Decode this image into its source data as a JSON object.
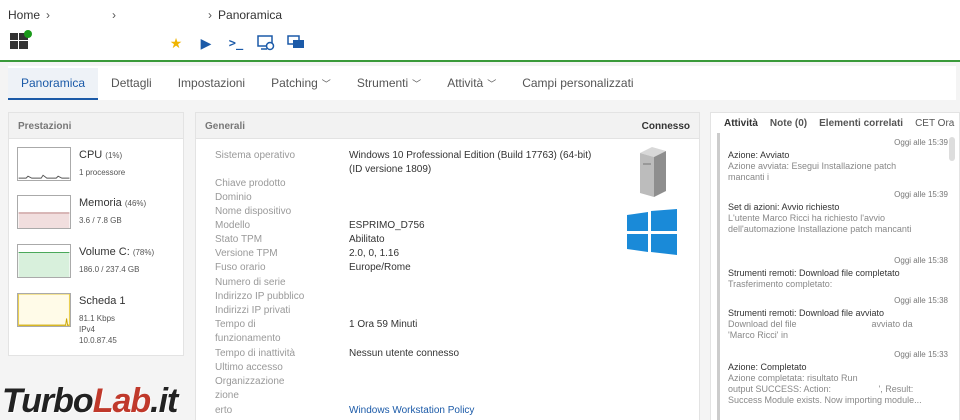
{
  "breadcrumb": {
    "home": "Home",
    "current": "Panoramica"
  },
  "tabs": [
    {
      "label": "Panoramica"
    },
    {
      "label": "Dettagli"
    },
    {
      "label": "Impostazioni"
    },
    {
      "label": "Patching"
    },
    {
      "label": "Strumenti"
    },
    {
      "label": "Attività"
    },
    {
      "label": "Campi personalizzati"
    }
  ],
  "performance": {
    "header": "Prestazioni",
    "cpu": {
      "name": "CPU",
      "pct": "(1%)",
      "sub": "1 processore"
    },
    "memory": {
      "name": "Memoria",
      "pct": "(46%)",
      "sub": "3.6 / 7.8 GB"
    },
    "volume": {
      "name": "Volume C:",
      "pct": "(78%)",
      "sub": "186.0 / 237.4 GB"
    },
    "nic": {
      "name": "Scheda 1",
      "sub1": "81.1 Kbps",
      "sub2": "IPv4",
      "sub3": "10.0.87.45"
    }
  },
  "general": {
    "header": "Generali",
    "status": "Connesso",
    "labels": [
      "Sistema operativo",
      "Chiave prodotto",
      "Dominio",
      "Nome dispositivo",
      "Modello",
      "Stato TPM",
      "Versione TPM",
      "Fuso orario",
      "Numero di serie",
      "Indirizzo IP pubblico",
      "Indirizzi IP privati",
      "Tempo di",
      "funzionamento",
      "Tempo di inattività",
      "Ultimo accesso",
      "Organizzazione",
      "zione",
      "erto"
    ],
    "os": "Windows 10 Professional Edition (Build 17763) (64-bit)",
    "os2": "(ID versione 1809)",
    "model": "ESPRIMO_D756",
    "tpm_state": "Abilitato",
    "tpm_version": "2.0, 0, 1.16",
    "timezone": "Europe/Rome",
    "uptime": "1 Ora 59 Minuti",
    "idle": "Nessun utente connesso",
    "policy": "Windows Workstation Policy"
  },
  "activity": {
    "tabs": [
      "Attività",
      "Note (0)",
      "Elementi correlati",
      "CET Ora"
    ],
    "entries": [
      {
        "time": "Oggi alle 15:39",
        "title": "Azione: Avviato",
        "d1": "Azione avviata: Esegui Installazione patch",
        "d2": "mancanti i"
      },
      {
        "time": "Oggi alle 15:39",
        "title": "Set di azioni: Avvio richiesto",
        "d1": "L'utente Marco Ricci ha richiesto l'avvio",
        "d2": "dell'automazione Installazione patch mancanti"
      },
      {
        "time": "Oggi alle 15:38",
        "title": "Strumenti remoti: Download file completato",
        "d1": "Trasferimento completato:",
        "d2": ""
      },
      {
        "time": "Oggi alle 15:38",
        "title": "Strumenti remoti: Download file avviato",
        "d1": "Download del file                              avviato da",
        "d2": "'Marco Ricci' in"
      },
      {
        "time": "Oggi alle 15:33",
        "title": "Azione: Completato",
        "d1": "Azione completata: risultato Run",
        "d2": "output SUCCESS: Action:                   ', Result:",
        "d3": "Success Module exists. Now importing module..."
      }
    ]
  },
  "watermark": {
    "part1": "Turbo",
    "part2": "Lab",
    "part3": ".it"
  }
}
